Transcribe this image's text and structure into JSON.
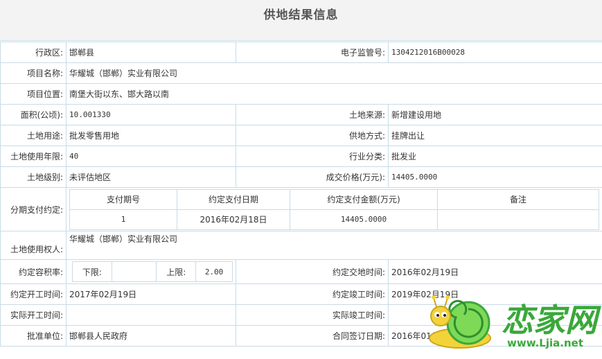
{
  "title": "供地结果信息",
  "rows": {
    "district_label": "行政区:",
    "district": "邯郸县",
    "supervision_label": "电子监管号:",
    "supervision": "1304212016B00028",
    "project_name_label": "项目名称:",
    "project_name": "华耀城（邯郸）实业有限公司",
    "project_location_label": "项目位置:",
    "project_location": "南堡大街以东、邯大路以南",
    "area_label": "面积(公顷):",
    "area": "10.001330",
    "source_label": "土地来源:",
    "source": "新增建设用地",
    "use_label": "土地用途:",
    "use": "批发零售用地",
    "supply_label": "供地方式:",
    "supply": "挂牌出让",
    "years_label": "土地使用年限:",
    "years": "40",
    "industry_label": "行业分类:",
    "industry": "批发业",
    "level_label": "土地级别:",
    "level": "未评估地区",
    "price_label": "成交价格(万元):",
    "price": "14405.0000",
    "installment_label": "分期支付约定:",
    "installment_headers": [
      "支付期号",
      "约定支付日期",
      "约定支付金额(万元)",
      "备注"
    ],
    "installment_row": [
      "1",
      "2016年02月18日",
      "14405.0000",
      ""
    ],
    "holder_label": "土地使用权人:",
    "holder": "华耀城（邯郸）实业有限公司",
    "far_label": "约定容积率:",
    "far_lower_label": "下限:",
    "far_lower": "",
    "far_upper_label": "上限:",
    "far_upper": "2.00",
    "delivery_label": "约定交地时间:",
    "delivery": "2016年02月19日",
    "start_label": "约定开工时间:",
    "start": "2017年02月19日",
    "finish_label": "约定竣工时间:",
    "finish": "2019年02月19日",
    "actual_start_label": "实际开工时间:",
    "actual_start": "",
    "actual_finish_label": "实际竣工时间:",
    "actual_finish": "",
    "approver_label": "批准单位:",
    "approver": "邯郸县人民政府",
    "contract_label": "合同签订日期:",
    "contract": "2016年01月19日"
  },
  "watermark": {
    "brand": "恋家网",
    "url": "www.Ljia.net"
  },
  "colors": {
    "border": "#c7dbe8",
    "header_bg": "#f3f3f3",
    "brand_green": "#3aa83a"
  }
}
